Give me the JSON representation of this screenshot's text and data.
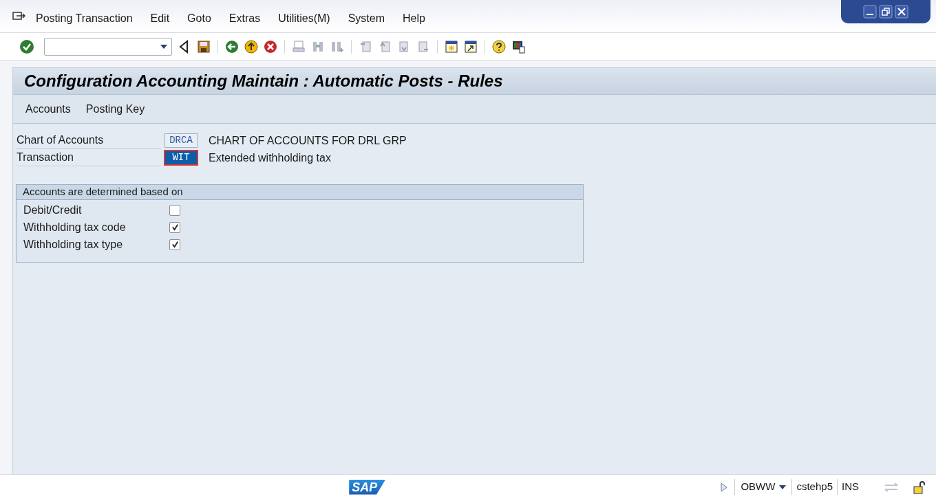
{
  "menu": [
    "Posting Transaction",
    "Edit",
    "Goto",
    "Extras",
    "Utilities(M)",
    "System",
    "Help"
  ],
  "title": "Configuration Accounting Maintain : Automatic Posts - Rules",
  "app_toolbar": [
    "Accounts",
    "Posting Key"
  ],
  "fields": [
    {
      "label": "Chart of Accounts",
      "value": "DRCA",
      "description": "CHART OF ACCOUNTS FOR DRL GRP",
      "selected": false
    },
    {
      "label": "Transaction",
      "value": "WIT",
      "description": "Extended withholding tax",
      "selected": true
    }
  ],
  "group": {
    "title": "Accounts are determined based on",
    "options": [
      {
        "label": "Debit/Credit",
        "checked": false
      },
      {
        "label": "Withholding tax code",
        "checked": true
      },
      {
        "label": "Withholding tax type",
        "checked": true
      }
    ]
  },
  "status_bar": {
    "logo": "SAP",
    "transaction": "OBWW",
    "server": "cstehp5",
    "mode": "INS"
  }
}
